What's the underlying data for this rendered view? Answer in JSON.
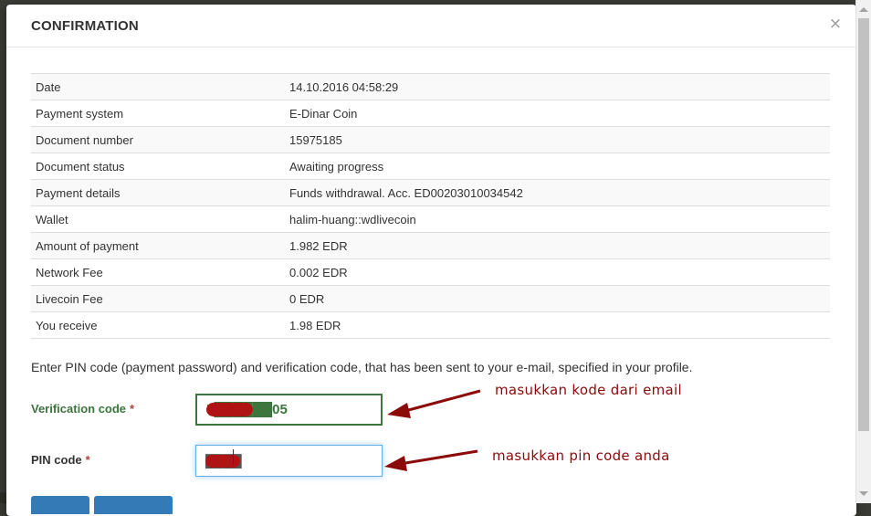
{
  "modal": {
    "title": "CONFIRMATION",
    "close_label": "×"
  },
  "details": [
    {
      "label": "Date",
      "value": "14.10.2016 04:58:29"
    },
    {
      "label": "Payment system",
      "value": "E-Dinar Coin"
    },
    {
      "label": "Document number",
      "value": "15975185"
    },
    {
      "label": "Document status",
      "value": "Awaiting progress"
    },
    {
      "label": "Payment details",
      "value": "Funds withdrawal. Acc. ED00203010034542"
    },
    {
      "label": "Wallet",
      "value": "halim-huang::wdlivecoin"
    },
    {
      "label": "Amount of payment",
      "value": "1.982 EDR"
    },
    {
      "label": "Network Fee",
      "value": "0.002 EDR"
    },
    {
      "label": "Livecoin Fee",
      "value": "0 EDR"
    },
    {
      "label": "You receive",
      "value": "1.98 EDR"
    }
  ],
  "instructions": "Enter PIN code (payment password) and verification code, that has been sent to your e-mail, specified in your profile.",
  "form": {
    "verification": {
      "label": "Verification code",
      "required_mark": "*",
      "value": "5██████05"
    },
    "pin": {
      "label": "PIN code",
      "required_mark": "*",
      "value": "████"
    }
  },
  "annotations": {
    "verification_note": "masukkan kode dari email",
    "pin_note": "masukkan pin code anda"
  },
  "colors": {
    "success_green": "#3c763d",
    "required_red": "#a94442",
    "focus_blue": "#66afe9",
    "annotation_red": "#8b0a0a",
    "redaction_red": "#b01313"
  }
}
